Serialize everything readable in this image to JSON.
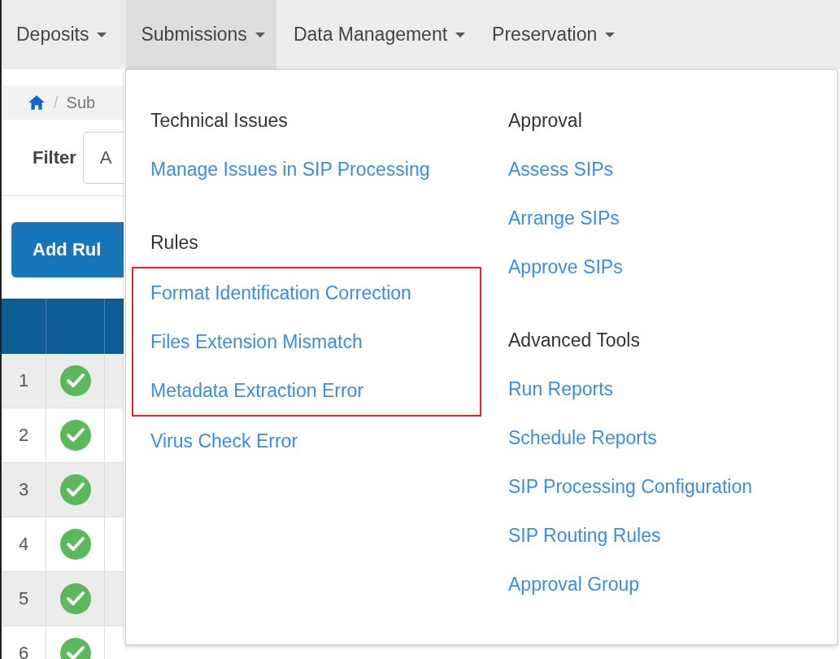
{
  "nav": [
    {
      "label": "Deposits",
      "selected": false
    },
    {
      "label": "Submissions",
      "selected": true
    },
    {
      "label": "Data Management",
      "selected": false
    },
    {
      "label": "Preservation",
      "selected": false
    }
  ],
  "breadcrumb": {
    "separator": "/",
    "current": "Sub"
  },
  "filter": {
    "label": "Filter",
    "value": "A"
  },
  "add_button": "Add Rul",
  "table": {
    "rows": [
      {
        "number": "1"
      },
      {
        "number": "2"
      },
      {
        "number": "3"
      },
      {
        "number": "4"
      },
      {
        "number": "5"
      },
      {
        "number": "6"
      }
    ]
  },
  "menu": {
    "columns": [
      {
        "sections": [
          {
            "heading": "Technical Issues",
            "items": [
              {
                "label": "Manage Issues in SIP Processing",
                "highlighted": false
              }
            ]
          },
          {
            "heading": "Rules",
            "items": [
              {
                "label": "Format Identification Correction",
                "highlighted": true
              },
              {
                "label": "Files Extension Mismatch",
                "highlighted": true
              },
              {
                "label": "Metadata Extraction Error",
                "highlighted": true
              },
              {
                "label": "Virus Check Error",
                "highlighted": false
              }
            ]
          }
        ]
      },
      {
        "sections": [
          {
            "heading": "Approval",
            "items": [
              {
                "label": "Assess SIPs",
                "highlighted": false
              },
              {
                "label": "Arrange SIPs",
                "highlighted": false
              },
              {
                "label": "Approve SIPs",
                "highlighted": false
              }
            ]
          },
          {
            "heading": "Advanced Tools",
            "items": [
              {
                "label": "Run Reports",
                "highlighted": false
              },
              {
                "label": "Schedule Reports",
                "highlighted": false
              },
              {
                "label": "SIP Processing Configuration",
                "highlighted": false
              },
              {
                "label": "SIP Routing Rules",
                "highlighted": false
              },
              {
                "label": "Approval Group",
                "highlighted": false
              }
            ]
          }
        ]
      }
    ]
  }
}
